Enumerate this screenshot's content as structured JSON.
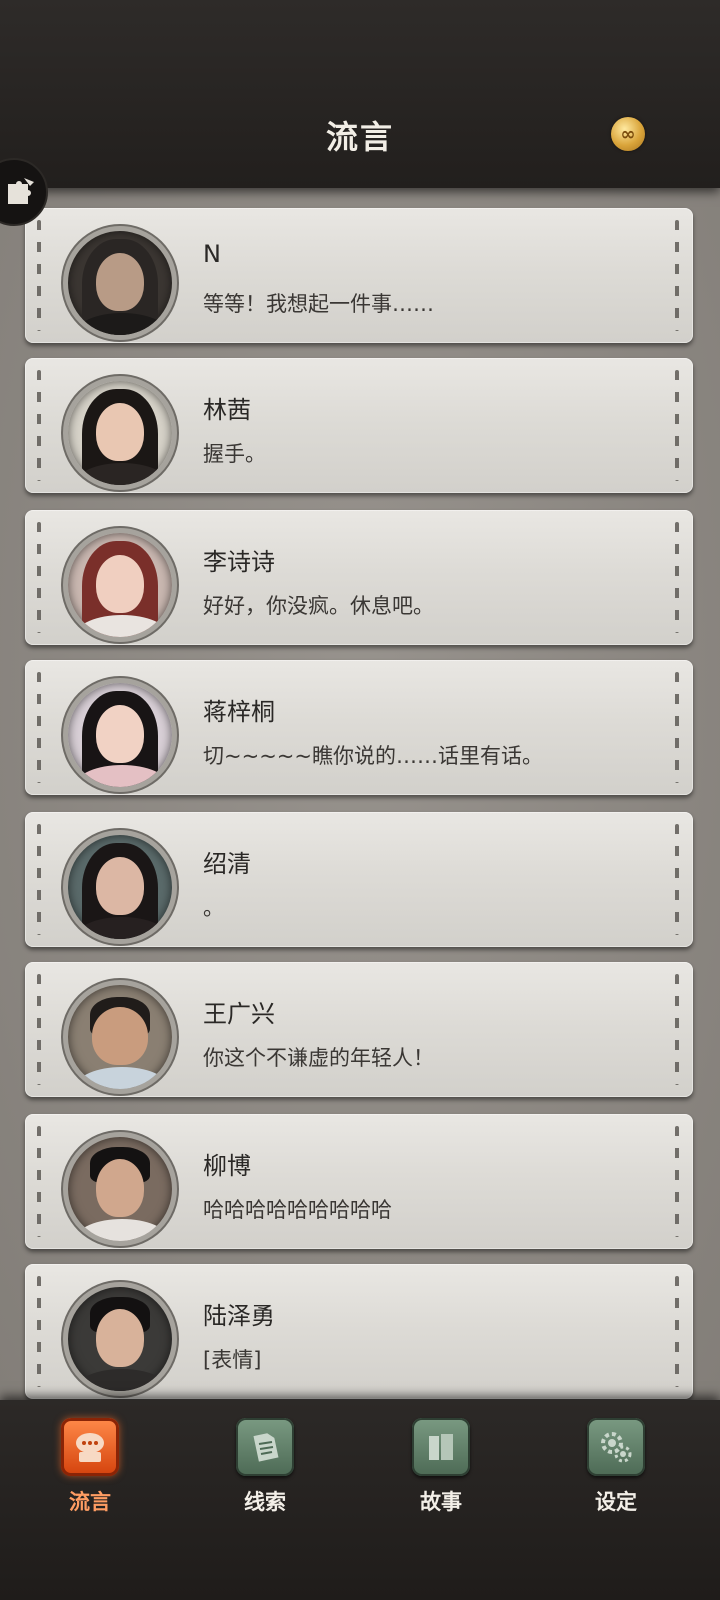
{
  "header": {
    "title": "流言",
    "coin_icon": "infinity-coin-icon"
  },
  "side_tab": {
    "icon": "puzzle-icon"
  },
  "messages": [
    {
      "name": "N",
      "text": "等等！我想起一件事……",
      "avatar": "avatar-n"
    },
    {
      "name": "林茜",
      "text": "握手。",
      "avatar": "avatar-linxi"
    },
    {
      "name": "李诗诗",
      "text": "好好，你没疯。休息吧。",
      "avatar": "avatar-lishishi"
    },
    {
      "name": "蒋梓桐",
      "text": "切~~~~~瞧你说的……话里有话。",
      "avatar": "avatar-jiangzitong"
    },
    {
      "name": "绍清",
      "text": "。",
      "avatar": "avatar-shaoqing"
    },
    {
      "name": "王广兴",
      "text": "你这个不谦虚的年轻人！",
      "avatar": "avatar-wangguangxing"
    },
    {
      "name": "柳博",
      "text": "哈哈哈哈哈哈哈哈哈",
      "avatar": "avatar-liubo"
    },
    {
      "name": "陆泽勇",
      "text": "[表情]",
      "avatar": "avatar-luzeyong"
    }
  ],
  "tabs": [
    {
      "label": "流言",
      "icon": "chat-bubble-icon",
      "active": true
    },
    {
      "label": "线索",
      "icon": "document-icon",
      "active": false
    },
    {
      "label": "故事",
      "icon": "book-icon",
      "active": false
    },
    {
      "label": "设定",
      "icon": "gear-icon",
      "active": false
    }
  ],
  "colors": {
    "accent": "#e0561a",
    "tab_green": "#5f7f68"
  }
}
